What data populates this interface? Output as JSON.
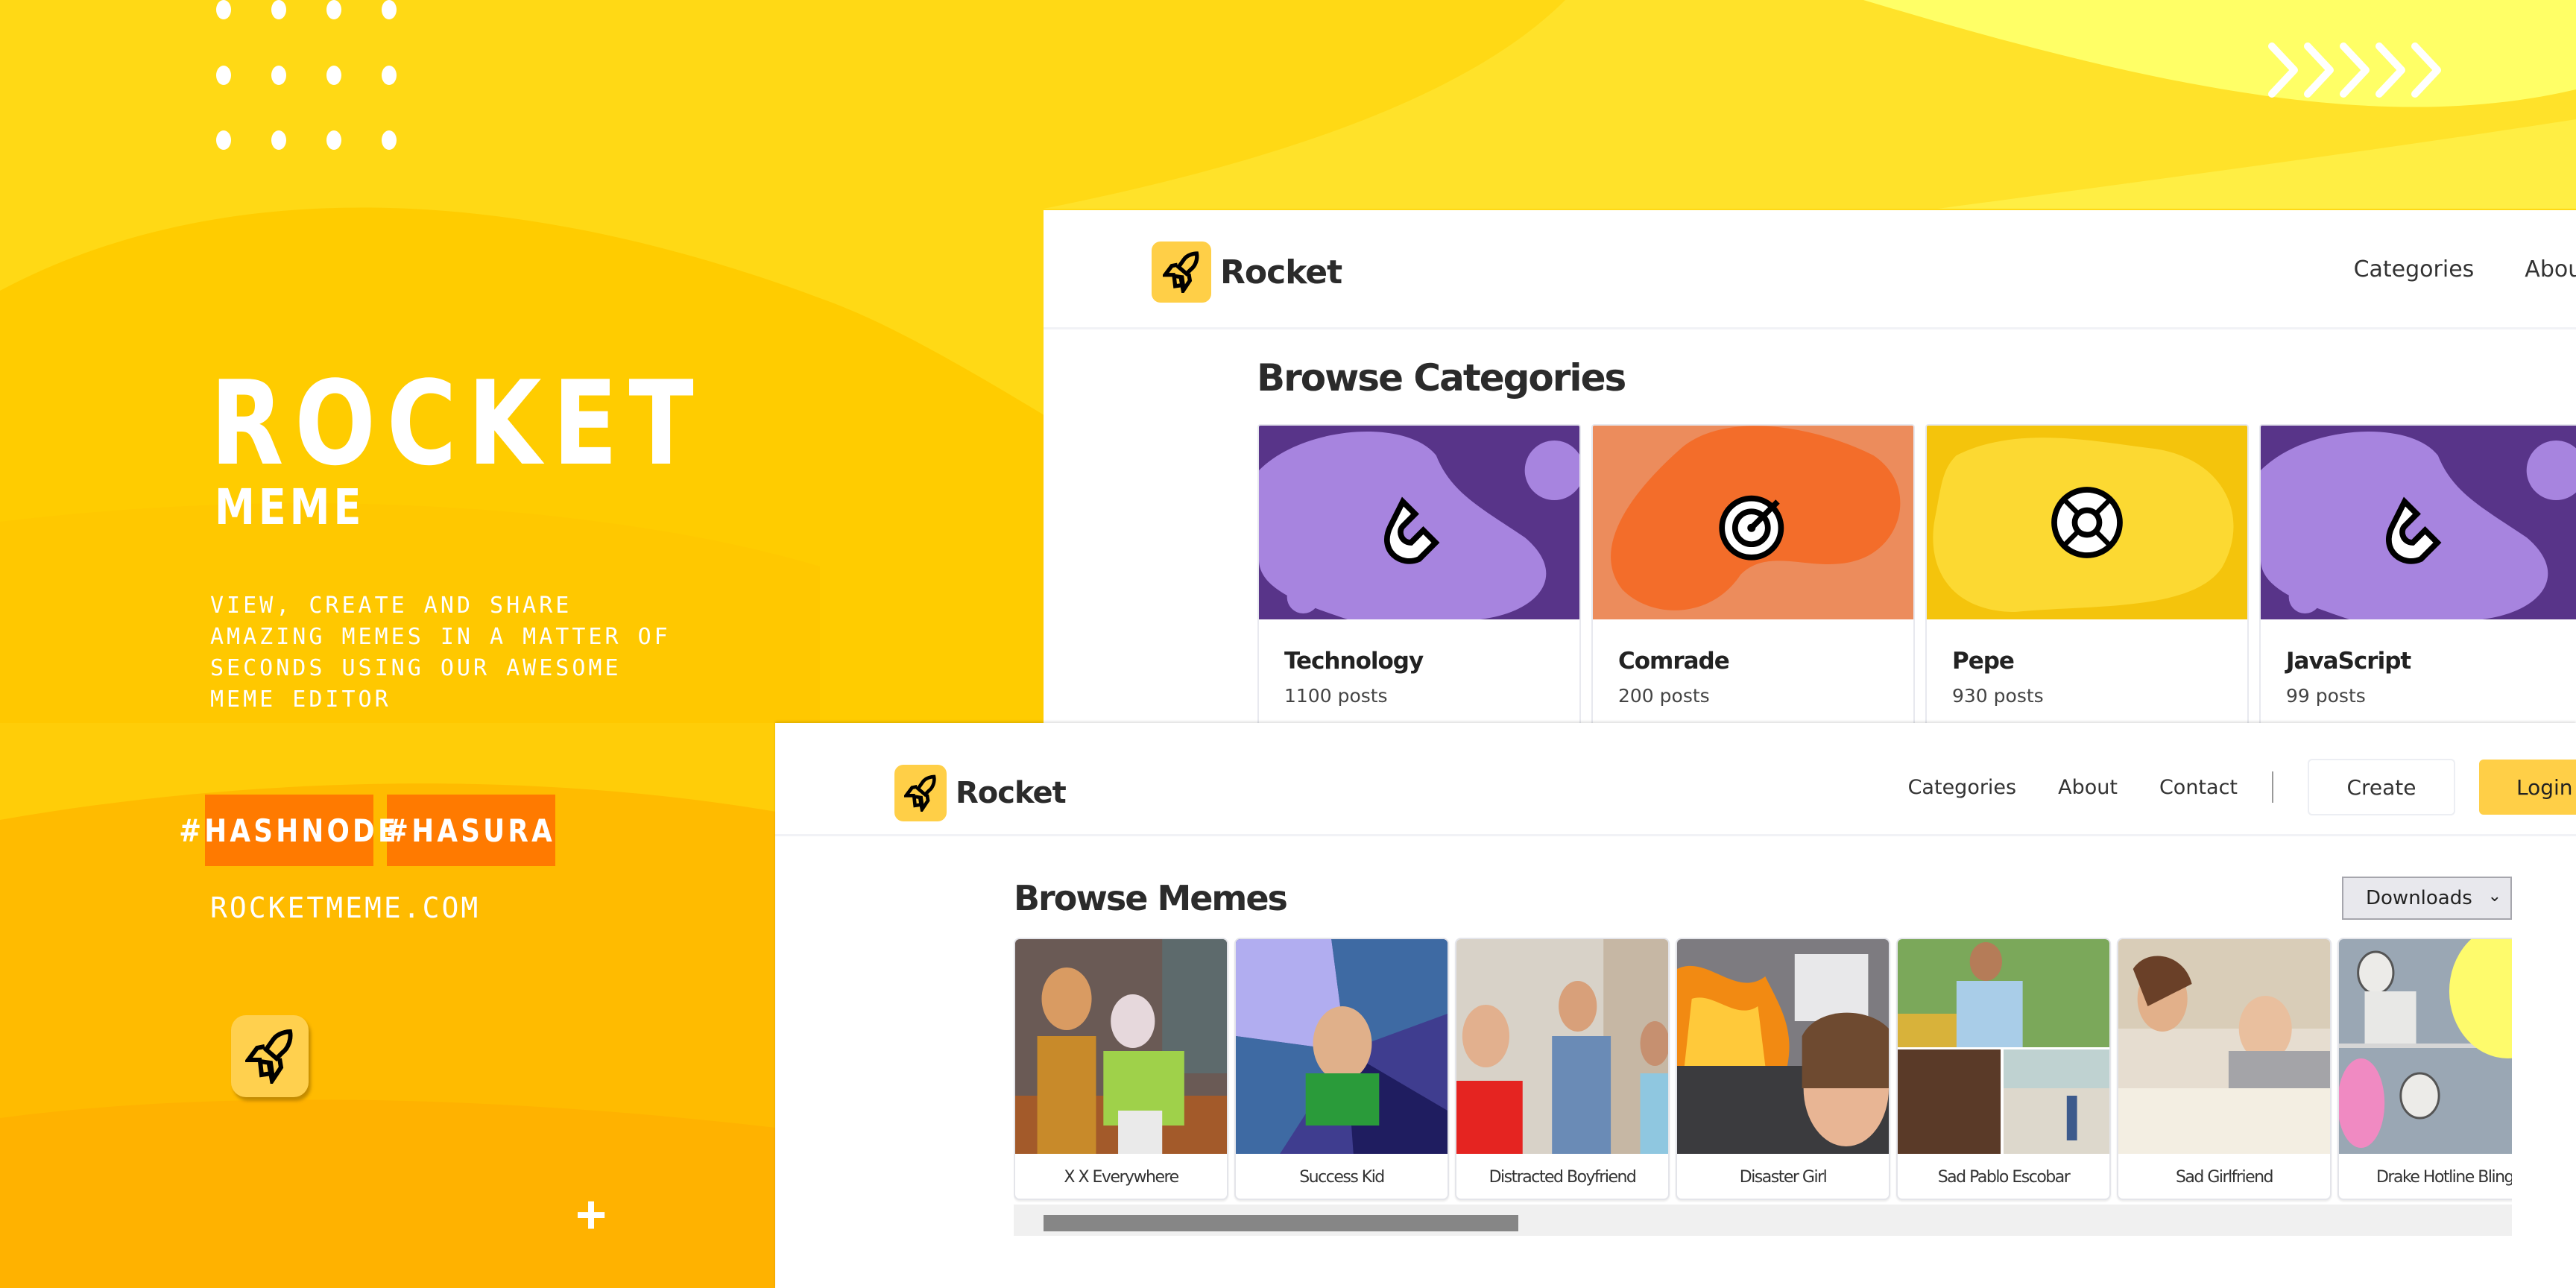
{
  "poster": {
    "title": "ROCKET",
    "subtitle": "MEME",
    "tagline": "View, create and share amazing memes in a matter of seconds using our awesome meme editor",
    "hashtags": [
      "#HASHNODE",
      "#HASURA"
    ],
    "site_url": "ROCKETMEME.COM",
    "colors": {
      "background": "#ffd015",
      "hashtag_bg": "#ff7a00",
      "accent": "#ffcf47"
    }
  },
  "categories_window": {
    "brand": "Rocket",
    "nav": [
      "Categories",
      "About"
    ],
    "section_title": "Browse Categories",
    "categories": [
      {
        "name": "Technology",
        "count": "1100 posts",
        "theme": "purple",
        "icon": "magnet-icon"
      },
      {
        "name": "Comrade",
        "count": "200 posts",
        "theme": "orange",
        "icon": "target-icon"
      },
      {
        "name": "Pepe",
        "count": "930 posts",
        "theme": "yellow",
        "icon": "lifebuoy-icon"
      },
      {
        "name": "JavaScript",
        "count": "99 posts",
        "theme": "purple",
        "icon": "magnet-icon"
      }
    ]
  },
  "memes_window": {
    "brand": "Rocket",
    "nav": [
      "Categories",
      "About",
      "Contact"
    ],
    "create_label": "Create",
    "login_label": "Login",
    "section_title": "Browse Memes",
    "sort": {
      "selected": "Downloads"
    },
    "memes": [
      {
        "title": "X X Everywhere"
      },
      {
        "title": "Success Kid"
      },
      {
        "title": "Distracted Boyfriend"
      },
      {
        "title": "Disaster Girl"
      },
      {
        "title": "Sad Pablo Escobar"
      },
      {
        "title": "Sad Girlfriend"
      },
      {
        "title": "Drake Hotline Bling"
      }
    ],
    "scroll_position": 0.0,
    "scroll_visible_fraction": 0.33
  }
}
